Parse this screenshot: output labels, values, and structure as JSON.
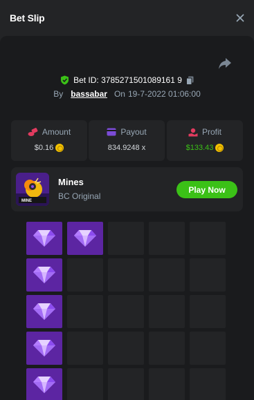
{
  "header": {
    "title": "Bet Slip"
  },
  "bet": {
    "id_label": "Bet ID:",
    "id": "3785271501089161 9",
    "by_label": "By",
    "user": "bassabar",
    "on_label": "On",
    "datetime": "19-7-2022 01:06:00"
  },
  "stats": {
    "amount": {
      "label": "Amount",
      "value": "$0.16"
    },
    "payout": {
      "label": "Payout",
      "value": "834.9248 x"
    },
    "profit": {
      "label": "Profit",
      "value": "$133.43"
    }
  },
  "game": {
    "name": "Mines",
    "provider": "BC Original",
    "thumb_caption": "MINE",
    "play_label": "Play Now"
  },
  "board": {
    "columns": 5,
    "visible_rows": 5,
    "cells": [
      "gem",
      "gem",
      "hidden",
      "hidden",
      "hidden",
      "gem",
      "hidden",
      "hidden",
      "hidden",
      "hidden",
      "gem",
      "hidden",
      "hidden",
      "hidden",
      "hidden",
      "gem",
      "hidden",
      "hidden",
      "hidden",
      "hidden",
      "gem",
      "hidden",
      "hidden",
      "hidden",
      "hidden"
    ]
  },
  "colors": {
    "accent_green": "#3bc117",
    "gem_tile": "#5c25a2",
    "hidden_tile": "#232426",
    "muted_text": "#98a7b5"
  },
  "icons": {
    "close": "close-icon",
    "share": "share-icon",
    "verified": "shield-check-icon",
    "copy": "copy-icon",
    "amount": "coins-icon",
    "payout": "wallet-icon",
    "profit": "profit-icon",
    "currency": "bcd-coin-icon",
    "gem": "diamond-icon"
  }
}
